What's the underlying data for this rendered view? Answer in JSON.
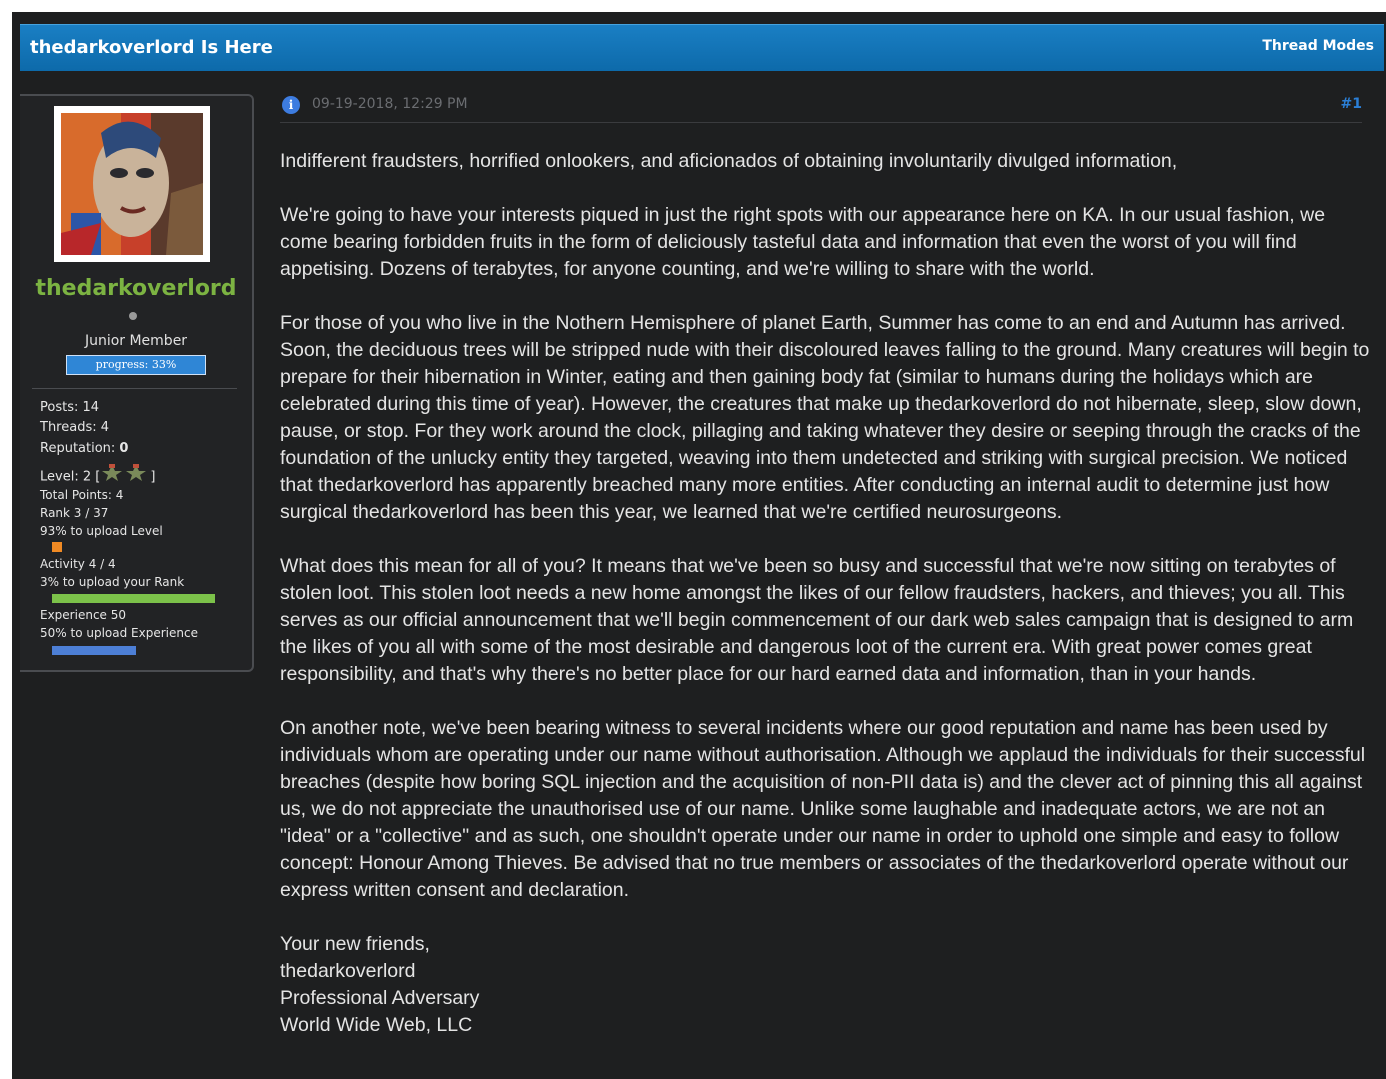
{
  "thread": {
    "title": "thedarkoverlord Is Here",
    "modes_label": "Thread Modes"
  },
  "user": {
    "username": "thedarkoverlord",
    "title": "Junior Member",
    "progress_label": "progress: 33%",
    "stats": {
      "posts": "Posts: 14",
      "threads": "Threads: 4",
      "reputation_label": "Reputation: ",
      "reputation_value": "0",
      "level_prefix": "Level: 2 [",
      "level_suffix": "]",
      "total_points": "Total Points: 4",
      "rank": "Rank 3 / 37",
      "level_upload": "93% to upload Level",
      "activity": "Activity 4 / 4",
      "rank_upload": "3% to upload your Rank",
      "experience": "Experience 50",
      "experience_upload": "50% to upload Experience"
    },
    "colors": {
      "username": "#7cb342",
      "level_bar": "#f08a24",
      "rank_bar": "#7cc24a",
      "experience_bar": "#4d7fd6"
    }
  },
  "post": {
    "date": "09-19-2018, 12:29 PM",
    "number": "#1",
    "paragraphs": [
      "Indifferent fraudsters, horrified onlookers, and aficionados of obtaining involuntarily divulged information,",
      "We're going to have your interests piqued in just the right spots with our appearance here on KA. In our usual fashion, we come bearing forbidden fruits in the form of deliciously tasteful data and information that even the worst of you will find appetising. Dozens of terabytes, for anyone counting, and we're willing to share with the world.",
      "For those of you who live in the Nothern Hemisphere of planet Earth, Summer has come to an end and Autumn has arrived. Soon, the deciduous trees will be stripped nude with their discoloured leaves falling to the ground. Many creatures will begin to prepare for their hibernation in Winter, eating and then gaining body fat (similar to humans during the holidays which are celebrated during this time of year). However, the creatures that make up thedarkoverlord do not hibernate, sleep, slow down, pause, or stop. For they work around the clock, pillaging and taking whatever they desire or seeping through the cracks of the foundation of the unlucky entity they targeted, weaving into them undetected and striking with surgical precision. We noticed that thedarkoverlord has apparently breached many more entities. After conducting an internal audit to determine just how surgical thedarkoverlord has been this year, we learned that we're certified neurosurgeons.",
      "What does this mean for all of you? It means that we've been so busy and successful that we're now sitting on terabytes of stolen loot. This stolen loot needs a new home amongst the likes of our fellow fraudsters, hackers, and thieves; you all. This serves as our official announcement that we'll begin commencement of our dark web sales campaign that is designed to arm the likes of you all with some of the most desirable and dangerous loot of the current era. With great power comes great responsibility, and that's why there's no better place for our hard earned data and information, than in your hands.",
      "On another note, we've been bearing witness to several incidents where our good reputation and name has been used by individuals whom are operating under our name without authorisation. Although we applaud the individuals for their successful breaches (despite how boring SQL injection and the acquisition of non-PII data is) and the clever act of pinning this all against us, we do not appreciate the unauthorised use of our name. Unlike some laughable and inadequate actors, we are not an \"idea\" or a \"collective\" and as such, one shouldn't operate under our name in order to uphold one simple and easy to follow concept: Honour Among Thieves. Be advised that no true members or associates of the thedarkoverlord operate without our express written consent and declaration."
    ],
    "signature": [
      "Your new friends,",
      "thedarkoverlord",
      "Professional Adversary",
      "World Wide Web, LLC"
    ]
  }
}
